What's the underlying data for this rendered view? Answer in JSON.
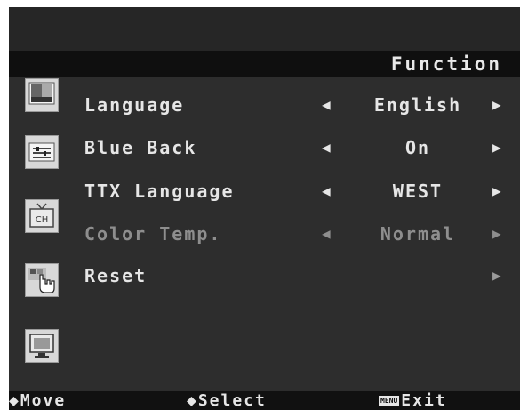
{
  "header": {
    "title": "Function"
  },
  "sidebar": {
    "icons": [
      "picture-icon",
      "audio-settings-icon",
      "tv-channel-icon",
      "function-hand-icon",
      "screen-icon"
    ]
  },
  "menu": {
    "items": [
      {
        "label": "Language",
        "value": "English",
        "left_arrow": "◀",
        "right_arrow": "▶",
        "enabled": true
      },
      {
        "label": "Blue Back",
        "value": "On",
        "left_arrow": "◀",
        "right_arrow": "▶",
        "enabled": true
      },
      {
        "label": "TTX Language",
        "value": "WEST",
        "left_arrow": "◀",
        "right_arrow": "▶",
        "enabled": true
      },
      {
        "label": "Color Temp.",
        "value": "Normal",
        "left_arrow": "◀",
        "right_arrow": "▶",
        "enabled": false
      },
      {
        "label": "Reset",
        "value": "",
        "left_arrow": "",
        "right_arrow": "▶",
        "enabled": true
      }
    ]
  },
  "footer": {
    "move_label": "Move",
    "move_glyph": "◆",
    "select_label": "Select",
    "select_glyph": "◆",
    "menu_key": "MENU",
    "exit_label": "Exit"
  },
  "colors": {
    "background": "#2d2d2d",
    "title_bar": "#0f0f0f",
    "text": "#e6e6e6",
    "disabled_text": "#8e8e8e"
  }
}
